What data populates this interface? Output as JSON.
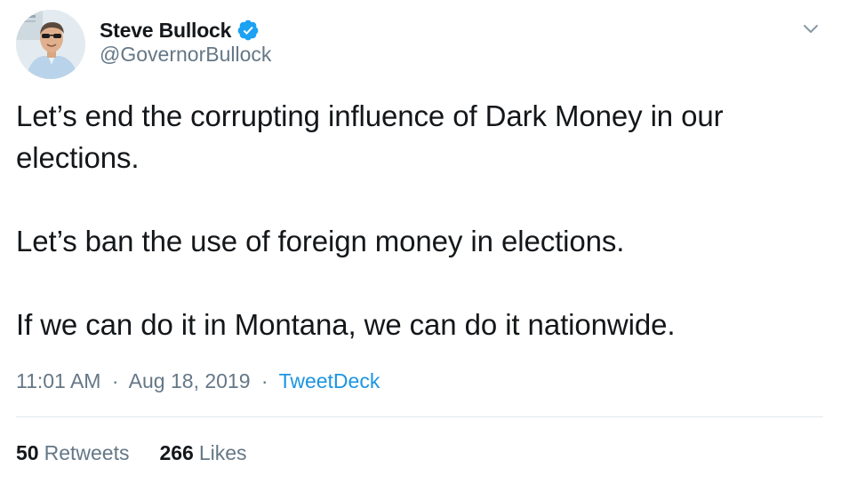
{
  "author": {
    "display_name": "Steve Bullock",
    "handle": "@GovernorBullock",
    "verified_icon": "verified-badge-icon",
    "avatar": "profile-photo"
  },
  "tweet": {
    "paragraphs": [
      "Let’s end the corrupting influence of Dark Money in our",
      "elections.",
      "Let’s ban the use of foreign money in elections.",
      "If we can do it in Montana, we can do it nationwide."
    ]
  },
  "meta": {
    "time": "11:01 AM",
    "date": "Aug 18, 2019",
    "separator": "·",
    "source": "TweetDeck"
  },
  "stats": {
    "retweets_count": "50",
    "retweets_label": "Retweets",
    "likes_count": "266",
    "likes_label": "Likes"
  },
  "colors": {
    "text": "#14171a",
    "secondary": "#657786",
    "accent": "#1b95e0",
    "verified": "#1da1f2",
    "divider": "#e1e8ed"
  },
  "icons": {
    "menu": "chevron-down-icon"
  }
}
